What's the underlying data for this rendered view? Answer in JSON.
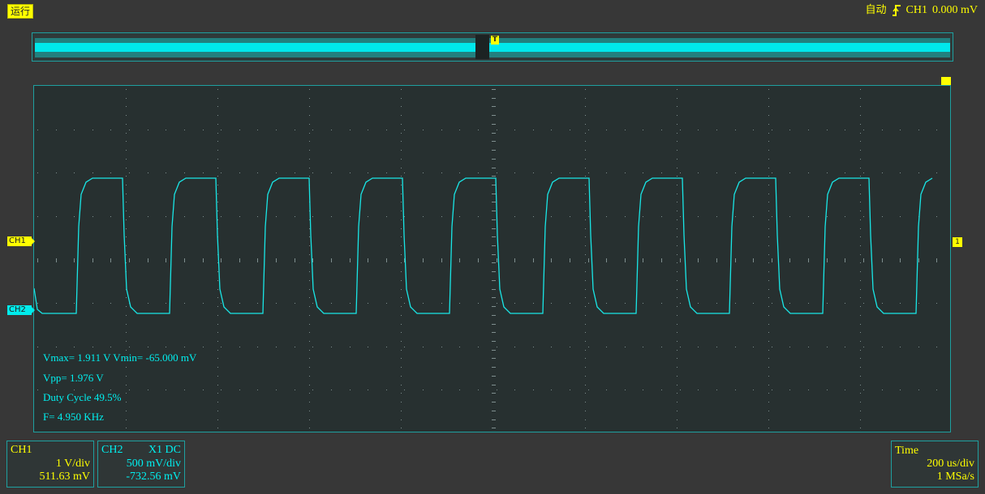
{
  "run_status": "运行",
  "trigger": {
    "mode": "自动",
    "slope_icon": "rising-edge-icon",
    "source": "CH1",
    "level": "0.000 mV"
  },
  "overview": {
    "trigger_label": "T"
  },
  "markers": {
    "ch1": "CH1",
    "ch2": "CH2",
    "right": "1"
  },
  "measurements": {
    "vmax_vmin": "Vmax= 1.911 V  Vmin= -65.000 mV",
    "vpp": "Vpp= 1.976 V",
    "duty": "Duty Cycle 49.5%",
    "freq": "F= 4.950 KHz"
  },
  "ch1_panel": {
    "title": "CH1",
    "scale": "1 V/div",
    "offset": "511.63 mV"
  },
  "ch2_panel": {
    "title": "CH2",
    "coupling": "X1  DC",
    "scale": "500 mV/div",
    "offset": "-732.56 mV"
  },
  "time_panel": {
    "title": "Time",
    "scale": "200 us/div",
    "rate": "1 MSa/s"
  },
  "colors": {
    "ch1": "#ffff00",
    "ch2": "#00f0f0",
    "grid": "#8a9a9a"
  }
}
